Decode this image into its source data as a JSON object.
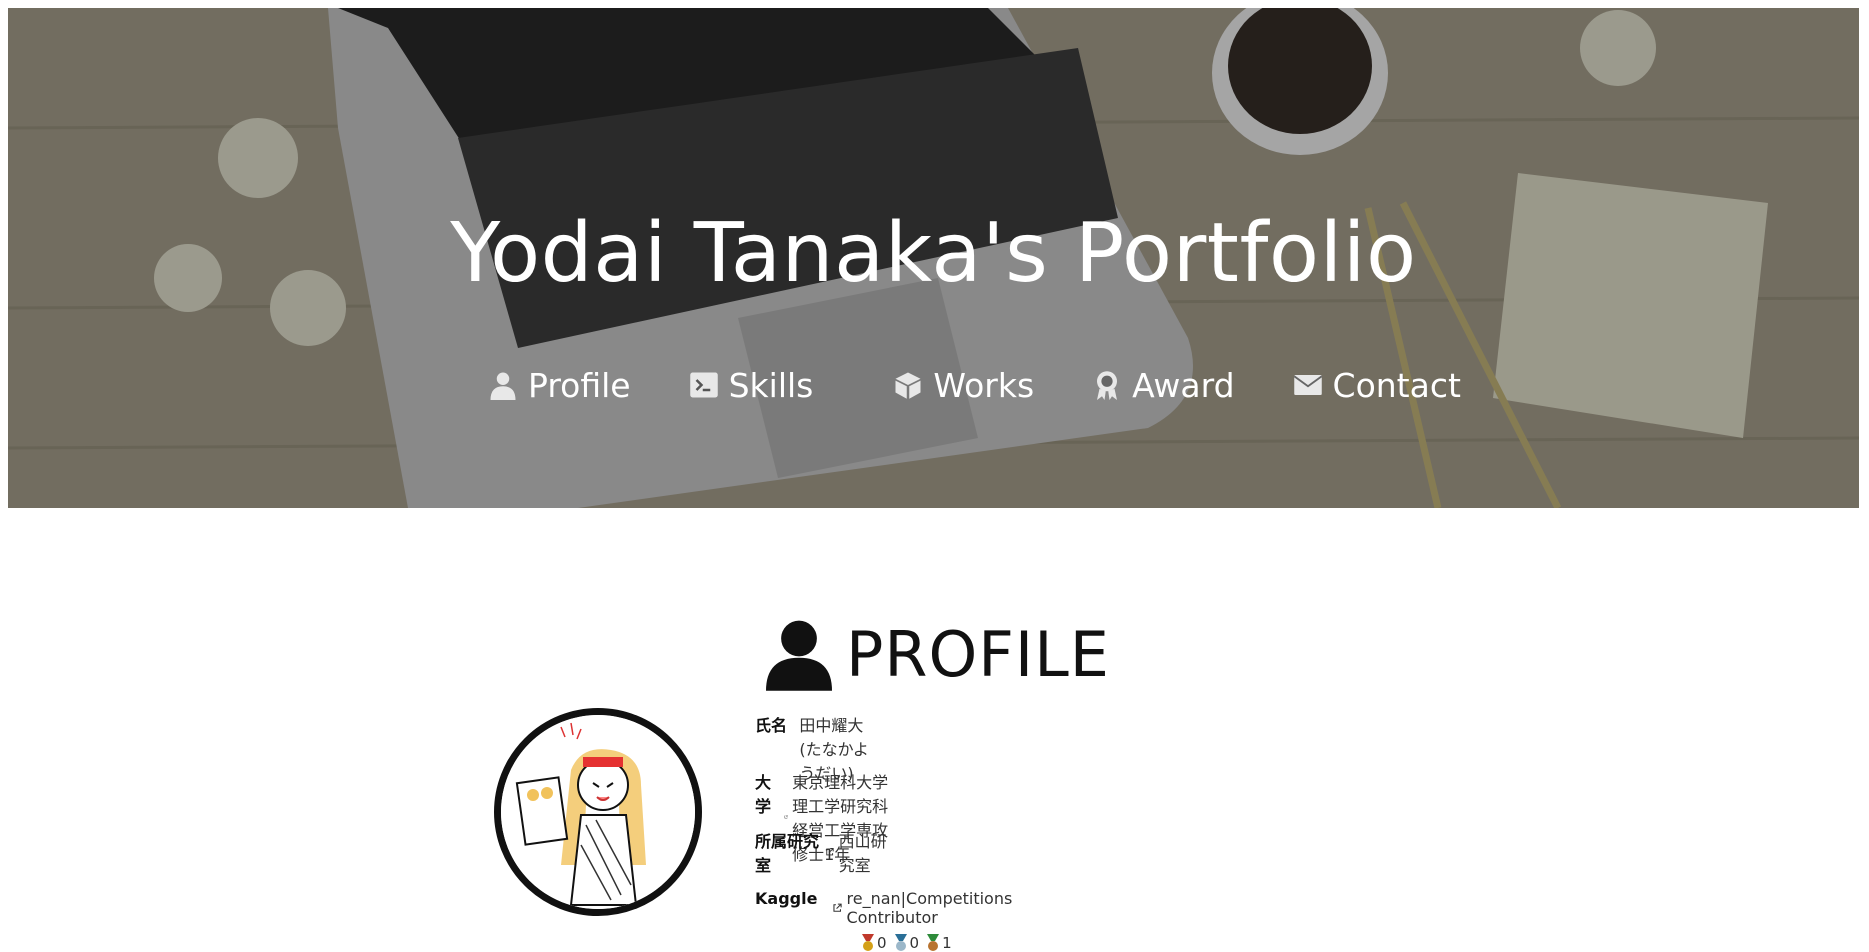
{
  "header": {
    "title": "Yodai Tanaka's Portfolio",
    "nav": [
      {
        "label": "Profile",
        "icon": "person-icon"
      },
      {
        "label": "Skills",
        "icon": "terminal-icon"
      },
      {
        "label": "Works",
        "icon": "box-icon"
      },
      {
        "label": "Award",
        "icon": "award-icon"
      },
      {
        "label": "Contact",
        "icon": "envelope-icon"
      }
    ]
  },
  "profile": {
    "section_title": "PROFILE",
    "rows": [
      {
        "label": "氏名",
        "value": "田中耀大(たなかようだい)"
      },
      {
        "label": "大学",
        "value": "東京理科大学 理工学研究科 経営工学専攻 修士1年"
      },
      {
        "label": "所属研究室",
        "value": "西山研究室"
      },
      {
        "label": "Kaggle",
        "value": "re_nan|Competitions Contributor"
      }
    ],
    "medals": [
      {
        "type": "gold",
        "count": "0",
        "color": "#d4a017"
      },
      {
        "type": "silver",
        "count": "0",
        "color": "#4a90b8"
      },
      {
        "type": "bronze",
        "count": "1",
        "color": "#2e8b3a"
      }
    ]
  }
}
